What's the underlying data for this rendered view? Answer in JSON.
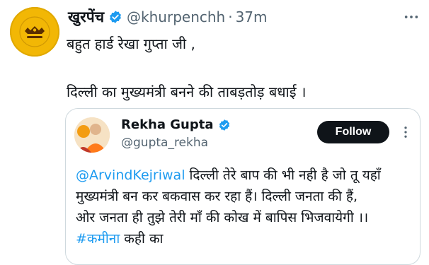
{
  "tweet": {
    "author_name": "खुरपेंच",
    "handle": "@khurpenchh",
    "separator": "·",
    "time": "37m",
    "more_icon": "more-horizontal-icon",
    "lines": [
      "बहुत हार्ड रेखा गुप्ता जी ,",
      "दिल्ली का मुख्यमंत्री बनने की ताबड़तोड़ बधाई ।"
    ],
    "avatar_logo": "खुरपेंच"
  },
  "quoted": {
    "author_name": "Rekha Gupta",
    "handle": "@gupta_rekha",
    "follow_label": "Follow",
    "mention": "@ArvindKejriwal",
    "line1_rest": " दिल्ली तेरे बाप की भी नही है जो तू यहाँ",
    "line2": "मुख्यमंत्री बन कर बकवास कर रहा हैं। दिल्ली जनता की हैं,",
    "line3": "ओर जनता ही तुझे तेरी माँ की कोख में बापिस भिजवायेगी ।।",
    "hashtag": "#कमीना",
    "line4_rest": " कही का"
  },
  "colors": {
    "link": "#1d9bf0",
    "verified": "#1d9bf0",
    "follow_bg": "#0f1419",
    "avatar_bg": "#f2b705"
  }
}
